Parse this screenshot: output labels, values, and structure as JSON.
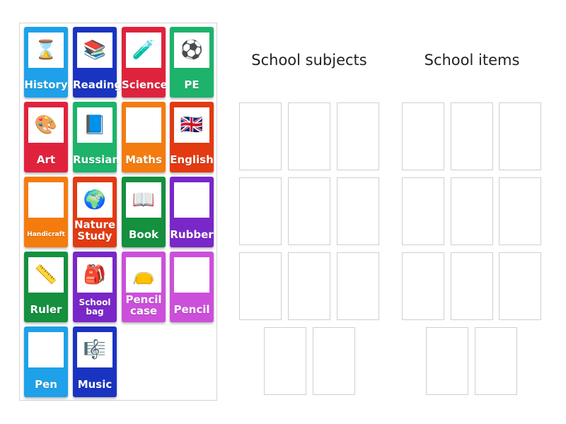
{
  "groups": [
    {
      "title": "School subjects"
    },
    {
      "title": "School items"
    }
  ],
  "cards": [
    {
      "label": "History",
      "color": "#1ea1e8",
      "icon": "hourglass-icon",
      "glyph": "⌛"
    },
    {
      "label": "Reading",
      "color": "#1a34c2",
      "icon": "books-icon",
      "glyph": "📚"
    },
    {
      "label": "Science",
      "color": "#e0233d",
      "icon": "science-kids-icon",
      "glyph": "🧪"
    },
    {
      "label": "PE",
      "color": "#1db36b",
      "icon": "sports-balls-icon",
      "glyph": "⚽"
    },
    {
      "label": "Art",
      "color": "#e0233d",
      "icon": "palette-icon",
      "glyph": "🎨"
    },
    {
      "label": "Russian",
      "color": "#1db36b",
      "icon": "russian-book-icon",
      "glyph": "📘"
    },
    {
      "label": "Maths",
      "color": "#f47c0f",
      "icon": "math-notes-icon",
      "glyph": "✏"
    },
    {
      "label": "English",
      "color": "#e33a12",
      "icon": "english-board-icon",
      "glyph": "🇬🇧"
    },
    {
      "label": "Handicraft",
      "color": "#f47c0f",
      "icon": "handicraft-icon",
      "glyph": "✂"
    },
    {
      "label": "Nature Study",
      "color": "#e33a12",
      "icon": "globe-icon",
      "glyph": "🌍"
    },
    {
      "label": "Book",
      "color": "#14903e",
      "icon": "book-stack-icon",
      "glyph": "📖"
    },
    {
      "label": "Rubber",
      "color": "#7a27c9",
      "icon": "eraser-icon",
      "glyph": "▭"
    },
    {
      "label": "Ruler",
      "color": "#14903e",
      "icon": "ruler-icon",
      "glyph": "📏"
    },
    {
      "label": "School bag",
      "color": "#7a27c9",
      "icon": "backpack-icon",
      "glyph": "🎒"
    },
    {
      "label": "Pencil case",
      "color": "#cc4fdb",
      "icon": "pencil-case-icon",
      "glyph": "👝"
    },
    {
      "label": "Pencil",
      "color": "#cc4fdb",
      "icon": "pencil-icon",
      "glyph": "✏"
    },
    {
      "label": "Pen",
      "color": "#1ea1e8",
      "icon": "pen-icon",
      "glyph": "🖊"
    },
    {
      "label": "Music",
      "color": "#1a34c2",
      "icon": "sheet-music-icon",
      "glyph": "🎼"
    }
  ]
}
